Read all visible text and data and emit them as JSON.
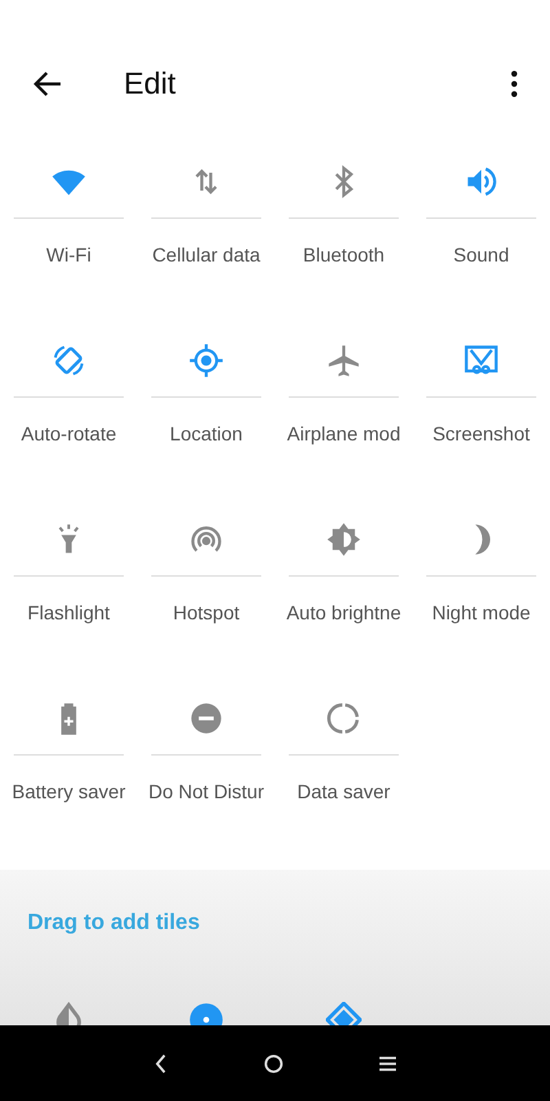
{
  "header": {
    "title": "Edit"
  },
  "tiles": [
    {
      "label": "Wi-Fi",
      "on": true
    },
    {
      "label": "Cellular data",
      "on": false
    },
    {
      "label": "Bluetooth",
      "on": false
    },
    {
      "label": "Sound",
      "on": true
    },
    {
      "label": "Auto-rotate",
      "on": true
    },
    {
      "label": "Location",
      "on": true
    },
    {
      "label": "Airplane mod",
      "on": false
    },
    {
      "label": "Screenshot",
      "on": true
    },
    {
      "label": "Flashlight",
      "on": false
    },
    {
      "label": "Hotspot",
      "on": false
    },
    {
      "label": "Auto brightne",
      "on": false
    },
    {
      "label": "Night mode",
      "on": false
    },
    {
      "label": "Battery saver",
      "on": false
    },
    {
      "label": "Do Not Distur",
      "on": false
    },
    {
      "label": "Data saver",
      "on": false
    }
  ],
  "tray": {
    "title": "Drag to add tiles",
    "tiles": [
      {
        "on": false
      },
      {
        "on": true
      },
      {
        "on": true
      }
    ]
  }
}
